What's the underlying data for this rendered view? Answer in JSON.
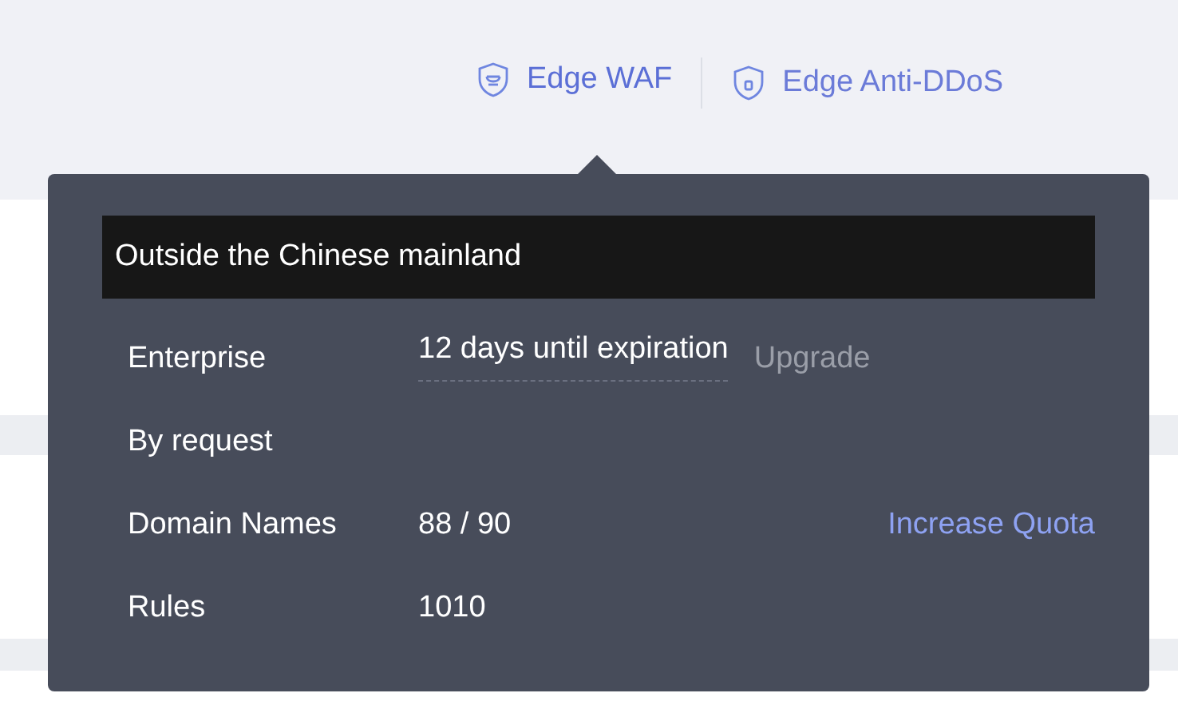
{
  "nav": [
    {
      "label": "Edge WAF",
      "kind": "waf",
      "selected": true
    },
    {
      "label": "Edge Anti-DDoS",
      "kind": "ddos",
      "selected": false
    }
  ],
  "tooltip": {
    "title": "Outside the Chinese mainland",
    "rows": [
      {
        "kind": "edition",
        "label": "Enterprise",
        "value": "12 days until expiration",
        "action": {
          "label": "Upgrade",
          "disabled": true
        }
      },
      {
        "kind": "plain",
        "label": "By request"
      },
      {
        "kind": "quota",
        "label": "Domain Names",
        "value": "88 / 90",
        "action": {
          "label": "Increase Quota",
          "disabled": false
        }
      },
      {
        "kind": "quota",
        "label": "Rules",
        "value": "1010"
      }
    ]
  }
}
